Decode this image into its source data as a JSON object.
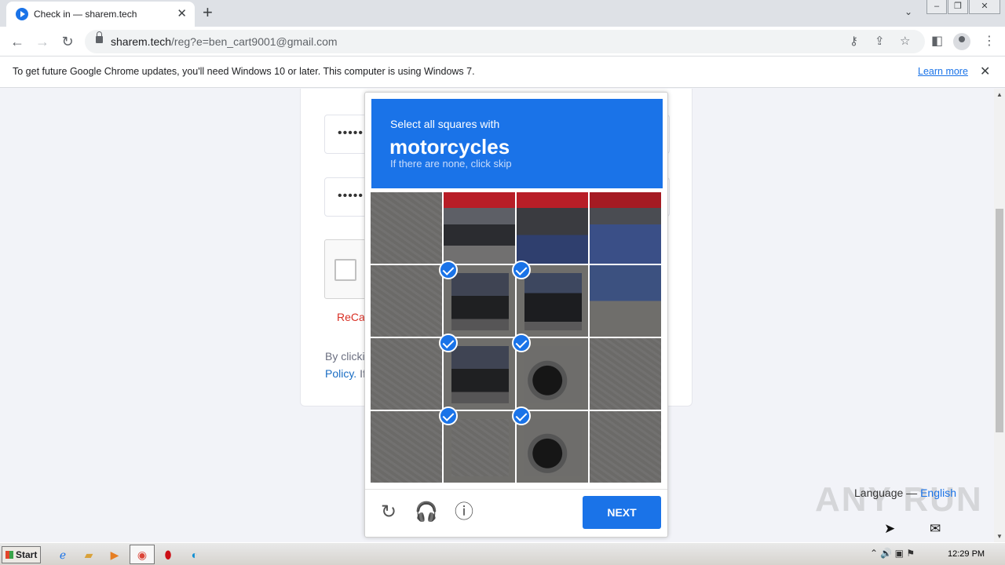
{
  "browser": {
    "tab_title": "Check in — sharem.tech",
    "url_domain": "sharem.tech",
    "url_path": "/reg?e=ben_cart9001@gmail.com",
    "infobar_text": "To get future Google Chrome updates, you'll need Windows 10 or later. This computer is using Windows 7.",
    "infobar_link": "Learn more"
  },
  "page": {
    "password_mask": "•••••",
    "confirm_mask": "•••••",
    "recaptcha_error": "ReCap",
    "terms_text": "By clicki",
    "terms_link": "Policy.",
    "terms_tail": "If",
    "language_label": "Language —",
    "language_value": "English",
    "watermark": "ANY RUN"
  },
  "captcha": {
    "prompt_line": "Select all squares with",
    "target": "motorcycles",
    "hint": "If there are none, click skip",
    "next_label": "NEXT",
    "accent_color": "#1a73e8",
    "tiles": [
      {
        "selected": false,
        "image": "road"
      },
      {
        "selected": false,
        "image": "rider-left"
      },
      {
        "selected": false,
        "image": "rider-center"
      },
      {
        "selected": false,
        "image": "road"
      },
      {
        "selected": false,
        "image": "road"
      },
      {
        "selected": true,
        "image": "motorcycle-front"
      },
      {
        "selected": true,
        "image": "motorcycle-front"
      },
      {
        "selected": false,
        "image": "jeans"
      },
      {
        "selected": false,
        "image": "road"
      },
      {
        "selected": true,
        "image": "motorcycle-front"
      },
      {
        "selected": true,
        "image": "motorcycle-wheel"
      },
      {
        "selected": false,
        "image": "road"
      },
      {
        "selected": false,
        "image": "road"
      },
      {
        "selected": true,
        "image": "road"
      },
      {
        "selected": true,
        "image": "motorcycle-wheel"
      },
      {
        "selected": false,
        "image": "road"
      }
    ]
  },
  "taskbar": {
    "start_label": "Start",
    "clock": "12:29 PM"
  }
}
